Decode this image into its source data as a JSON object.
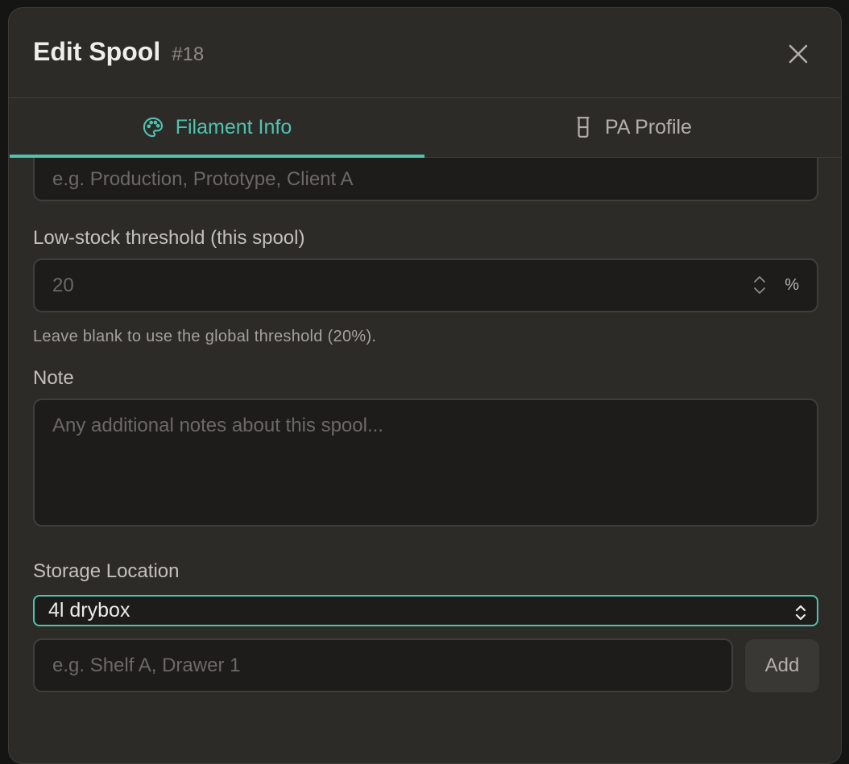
{
  "dialog": {
    "title": "Edit Spool",
    "spool_id": "#18"
  },
  "tabs": [
    {
      "label": "Filament Info",
      "icon": "palette-icon",
      "active": true
    },
    {
      "label": "PA Profile",
      "icon": "beaker-icon",
      "active": false
    }
  ],
  "project": {
    "placeholder": "e.g. Production, Prototype, Client A"
  },
  "threshold": {
    "label": "Low-stock threshold (this spool)",
    "placeholder": "20",
    "unit": "%",
    "help": "Leave blank to use the global threshold (20%)."
  },
  "note": {
    "label": "Note",
    "placeholder": "Any additional notes about this spool..."
  },
  "storage": {
    "label": "Storage Location",
    "selected": "4l drybox",
    "new_location_placeholder": "e.g. Shelf A, Drawer 1",
    "add_label": "Add"
  },
  "colors": {
    "accent": "#4fc3b0",
    "panel": "#2d2b28",
    "field": "#1d1c1a"
  }
}
